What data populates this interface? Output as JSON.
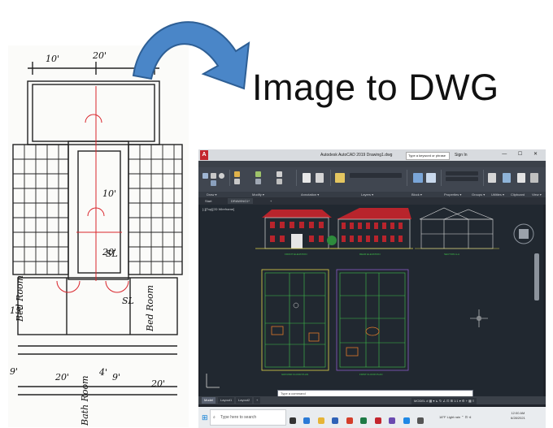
{
  "headline": "Image to DWG",
  "sketch": {
    "dims_top": [
      "10'",
      "20'"
    ],
    "labels": [
      "Bed Room",
      "Bed Room",
      "Bath Room",
      "SL",
      "SL"
    ],
    "dims_side": [
      "15'",
      "9'",
      "20'",
      "20'",
      "9'",
      "4'",
      "10'",
      "20'",
      "10'",
      "10'"
    ]
  },
  "autocad": {
    "app_title": "Autodesk AutoCAD 2019   Drawing1.dwg",
    "search_placeholder": "Type a keyword or phrase",
    "user": "Sign In",
    "window_buttons": "— ☐ ✕",
    "menu": [
      "Home",
      "Insert",
      "Annotate",
      "Parametric",
      "View",
      "Manage",
      "Output",
      "Add-ins",
      "A360",
      "Express Tools",
      "Featured Apps",
      "BIM 360",
      "Performance"
    ],
    "ribbon_groups": [
      "Draw ▾",
      "Modify ▾",
      "Annotation ▾",
      "Layers ▾",
      "Block ▾",
      "Properties ▾",
      "Groups ▾",
      "Utilities ▾",
      "Clipboard",
      "View ▾"
    ],
    "ribbon_tools": [
      "Line",
      "Polyline",
      "Circle",
      "Arc",
      "Move",
      "Rotate",
      "Trim",
      "Copy",
      "Mirror",
      "Fillet",
      "Stretch",
      "Scale",
      "Array",
      "Text",
      "Dimension",
      "Layer Properties",
      "Insert",
      "Match Properties",
      "ByLayer",
      "Group",
      "Measure",
      "Paste",
      "Base"
    ],
    "doc_tabs": [
      "Start",
      "DRAWING1*",
      "+"
    ],
    "viewport_label": "[-][Top][2D Wireframe]",
    "drawing_titles": [
      "FRONT ELEVATION",
      "REAR ELEVATION",
      "SECTION A-A",
      "GROUND FLOOR PLAN",
      "FIRST FLOOR PLAN"
    ],
    "command_prompt": "Type a command",
    "layout_tabs": [
      "Model",
      "Layout1",
      "Layout2",
      "+"
    ],
    "status_bar": "MODEL  #  ▦  ▾  ⊾  ↻  ∠  ⊡  ⊞  1:1 ▾  ⚙  +  ▦  ≡"
  },
  "taskbar": {
    "search_placeholder": "Type here to search",
    "weather": "18°F  Light rain  ⌃  ⊡  ⊲ ",
    "time": "12:00 AM",
    "date": "6/28/2021"
  },
  "colors": {
    "arrow_fill": "#4a86c8",
    "arrow_edge": "#2e5f95",
    "roof": "#b8242c",
    "cad_bg": "#212830",
    "cad_line_yellow": "#e0d34a",
    "cad_line_green": "#3ec24a"
  }
}
